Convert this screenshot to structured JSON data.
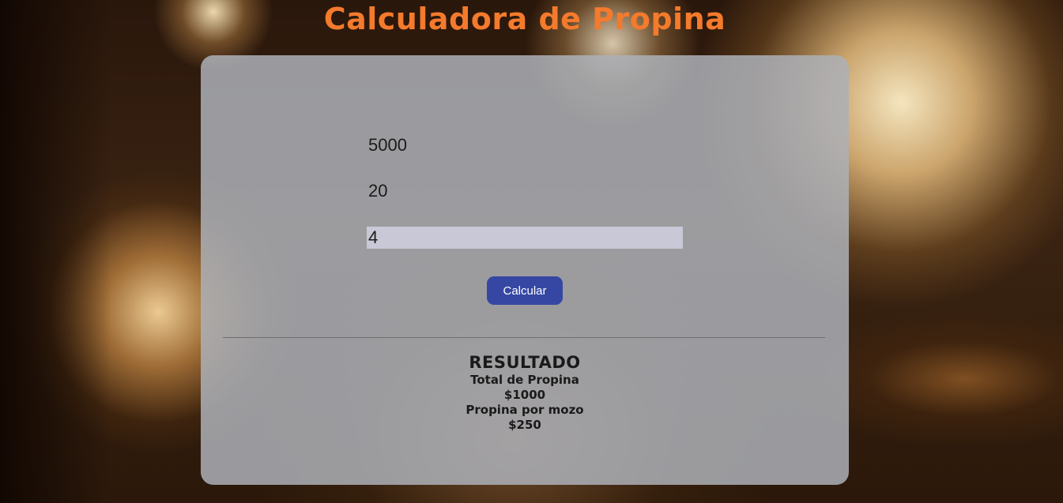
{
  "app": {
    "title": "Calculadora de Propina"
  },
  "form": {
    "bill_value": "5000",
    "percent_value": "20",
    "waiters_value": "4",
    "calculate_label": "Calcular"
  },
  "result": {
    "heading": "RESULTADO",
    "total_label": "Total de Propina",
    "total_value": "$1000",
    "per_waiter_label": "Propina por mozo",
    "per_waiter_value": "$250"
  },
  "colors": {
    "title": "#f47a2c",
    "button": "#3547a3",
    "card": "#acb0b7",
    "active_input": "#c8c8d6"
  }
}
